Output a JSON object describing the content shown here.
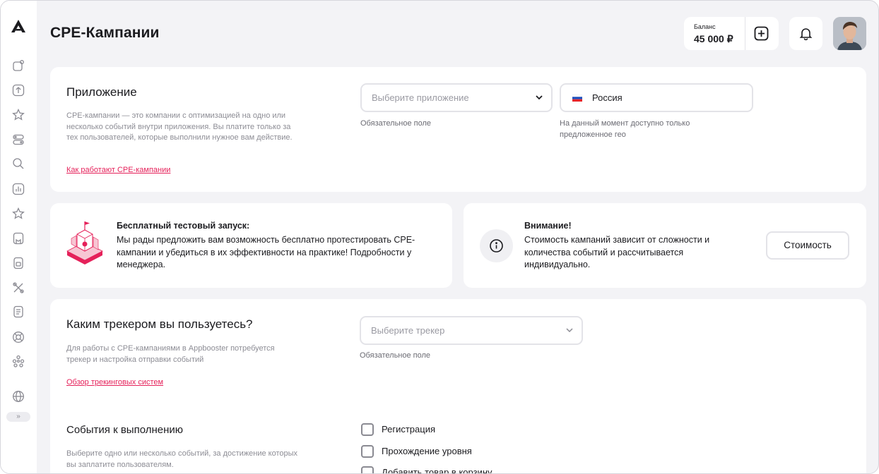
{
  "page": {
    "title": "CPE-Кампании"
  },
  "balance": {
    "label": "Баланс",
    "value": "45 000 ₽"
  },
  "sidebar": {
    "icons": [
      "apps-icon",
      "upload-icon",
      "star-badge-icon",
      "toggle-icon",
      "search-icon",
      "chart-icon",
      "star-icon",
      "bookmark-icon",
      "document-icon",
      "tools-icon",
      "report-icon",
      "support-icon",
      "network-icon",
      "globe-icon"
    ],
    "expand_label": "»"
  },
  "app_section": {
    "title": "Приложение",
    "description": "CPE-кампании — это компании с оптимизацией на одно или несколько событий внутри приложения. Вы платите только за тех пользователей, которые выполнили нужное вам действие.",
    "link": "Как работают CPE-кампании",
    "app_select_placeholder": "Выберите приложение",
    "app_hint": "Обязательное поле",
    "geo_value": "Россия",
    "geo_hint": "На данный момент доступно только предложенное гео"
  },
  "promo": {
    "title": "Бесплатный тестовый запуск:",
    "text": "Мы рады предложить вам возможность бесплатно протестировать CPE-кампании и убедиться в их эффективности на практике! Подробности у менеджера."
  },
  "notice": {
    "title": "Внимание!",
    "text": "Стоимость кампаний зависит от сложности и количества событий и рассчитывается индивидуально.",
    "button": "Стоимость"
  },
  "tracker_section": {
    "title": "Каким трекером вы пользуетесь?",
    "description": "Для работы с CPE-кампаниями в Appbooster потребуется трекер и настройка отправки событий",
    "link": "Обзор трекинговых систем",
    "select_placeholder": "Выберите трекер",
    "hint": "Обязательное поле"
  },
  "events_section": {
    "title": "События к выполнению",
    "description": "Выберите одно или несколько событий, за достижение которых вы заплатите пользователям.",
    "options": [
      "Регистрация",
      "Прохождение уровня",
      "Добавить товар в корзину"
    ]
  },
  "colors": {
    "accent": "#e5215a",
    "background": "#f3f3f6",
    "card": "#ffffff"
  }
}
